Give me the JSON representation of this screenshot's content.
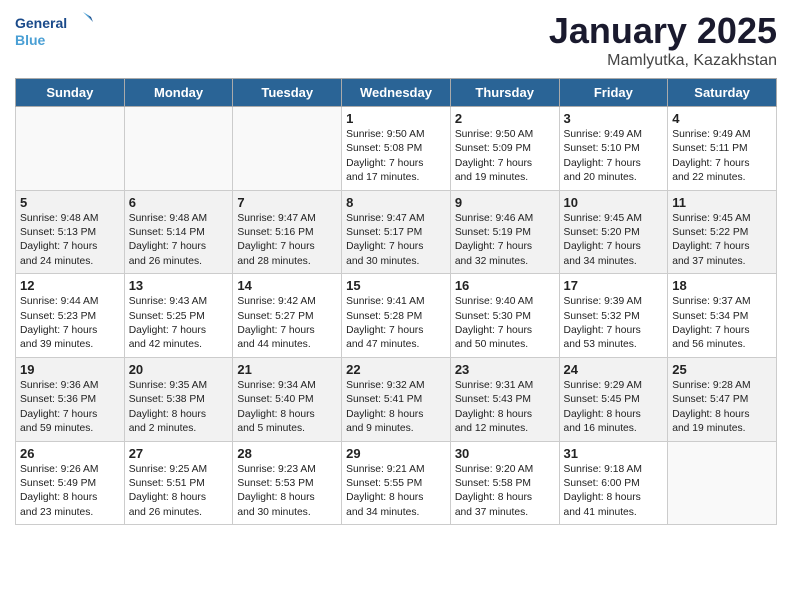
{
  "header": {
    "logo_line1": "General",
    "logo_line2": "Blue",
    "month": "January 2025",
    "location": "Mamlyutka, Kazakhstan"
  },
  "weekdays": [
    "Sunday",
    "Monday",
    "Tuesday",
    "Wednesday",
    "Thursday",
    "Friday",
    "Saturday"
  ],
  "weeks": [
    [
      {
        "day": "",
        "info": ""
      },
      {
        "day": "",
        "info": ""
      },
      {
        "day": "",
        "info": ""
      },
      {
        "day": "1",
        "info": "Sunrise: 9:50 AM\nSunset: 5:08 PM\nDaylight: 7 hours\nand 17 minutes."
      },
      {
        "day": "2",
        "info": "Sunrise: 9:50 AM\nSunset: 5:09 PM\nDaylight: 7 hours\nand 19 minutes."
      },
      {
        "day": "3",
        "info": "Sunrise: 9:49 AM\nSunset: 5:10 PM\nDaylight: 7 hours\nand 20 minutes."
      },
      {
        "day": "4",
        "info": "Sunrise: 9:49 AM\nSunset: 5:11 PM\nDaylight: 7 hours\nand 22 minutes."
      }
    ],
    [
      {
        "day": "5",
        "info": "Sunrise: 9:48 AM\nSunset: 5:13 PM\nDaylight: 7 hours\nand 24 minutes."
      },
      {
        "day": "6",
        "info": "Sunrise: 9:48 AM\nSunset: 5:14 PM\nDaylight: 7 hours\nand 26 minutes."
      },
      {
        "day": "7",
        "info": "Sunrise: 9:47 AM\nSunset: 5:16 PM\nDaylight: 7 hours\nand 28 minutes."
      },
      {
        "day": "8",
        "info": "Sunrise: 9:47 AM\nSunset: 5:17 PM\nDaylight: 7 hours\nand 30 minutes."
      },
      {
        "day": "9",
        "info": "Sunrise: 9:46 AM\nSunset: 5:19 PM\nDaylight: 7 hours\nand 32 minutes."
      },
      {
        "day": "10",
        "info": "Sunrise: 9:45 AM\nSunset: 5:20 PM\nDaylight: 7 hours\nand 34 minutes."
      },
      {
        "day": "11",
        "info": "Sunrise: 9:45 AM\nSunset: 5:22 PM\nDaylight: 7 hours\nand 37 minutes."
      }
    ],
    [
      {
        "day": "12",
        "info": "Sunrise: 9:44 AM\nSunset: 5:23 PM\nDaylight: 7 hours\nand 39 minutes."
      },
      {
        "day": "13",
        "info": "Sunrise: 9:43 AM\nSunset: 5:25 PM\nDaylight: 7 hours\nand 42 minutes."
      },
      {
        "day": "14",
        "info": "Sunrise: 9:42 AM\nSunset: 5:27 PM\nDaylight: 7 hours\nand 44 minutes."
      },
      {
        "day": "15",
        "info": "Sunrise: 9:41 AM\nSunset: 5:28 PM\nDaylight: 7 hours\nand 47 minutes."
      },
      {
        "day": "16",
        "info": "Sunrise: 9:40 AM\nSunset: 5:30 PM\nDaylight: 7 hours\nand 50 minutes."
      },
      {
        "day": "17",
        "info": "Sunrise: 9:39 AM\nSunset: 5:32 PM\nDaylight: 7 hours\nand 53 minutes."
      },
      {
        "day": "18",
        "info": "Sunrise: 9:37 AM\nSunset: 5:34 PM\nDaylight: 7 hours\nand 56 minutes."
      }
    ],
    [
      {
        "day": "19",
        "info": "Sunrise: 9:36 AM\nSunset: 5:36 PM\nDaylight: 7 hours\nand 59 minutes."
      },
      {
        "day": "20",
        "info": "Sunrise: 9:35 AM\nSunset: 5:38 PM\nDaylight: 8 hours\nand 2 minutes."
      },
      {
        "day": "21",
        "info": "Sunrise: 9:34 AM\nSunset: 5:40 PM\nDaylight: 8 hours\nand 5 minutes."
      },
      {
        "day": "22",
        "info": "Sunrise: 9:32 AM\nSunset: 5:41 PM\nDaylight: 8 hours\nand 9 minutes."
      },
      {
        "day": "23",
        "info": "Sunrise: 9:31 AM\nSunset: 5:43 PM\nDaylight: 8 hours\nand 12 minutes."
      },
      {
        "day": "24",
        "info": "Sunrise: 9:29 AM\nSunset: 5:45 PM\nDaylight: 8 hours\nand 16 minutes."
      },
      {
        "day": "25",
        "info": "Sunrise: 9:28 AM\nSunset: 5:47 PM\nDaylight: 8 hours\nand 19 minutes."
      }
    ],
    [
      {
        "day": "26",
        "info": "Sunrise: 9:26 AM\nSunset: 5:49 PM\nDaylight: 8 hours\nand 23 minutes."
      },
      {
        "day": "27",
        "info": "Sunrise: 9:25 AM\nSunset: 5:51 PM\nDaylight: 8 hours\nand 26 minutes."
      },
      {
        "day": "28",
        "info": "Sunrise: 9:23 AM\nSunset: 5:53 PM\nDaylight: 8 hours\nand 30 minutes."
      },
      {
        "day": "29",
        "info": "Sunrise: 9:21 AM\nSunset: 5:55 PM\nDaylight: 8 hours\nand 34 minutes."
      },
      {
        "day": "30",
        "info": "Sunrise: 9:20 AM\nSunset: 5:58 PM\nDaylight: 8 hours\nand 37 minutes."
      },
      {
        "day": "31",
        "info": "Sunrise: 9:18 AM\nSunset: 6:00 PM\nDaylight: 8 hours\nand 41 minutes."
      },
      {
        "day": "",
        "info": ""
      }
    ]
  ]
}
